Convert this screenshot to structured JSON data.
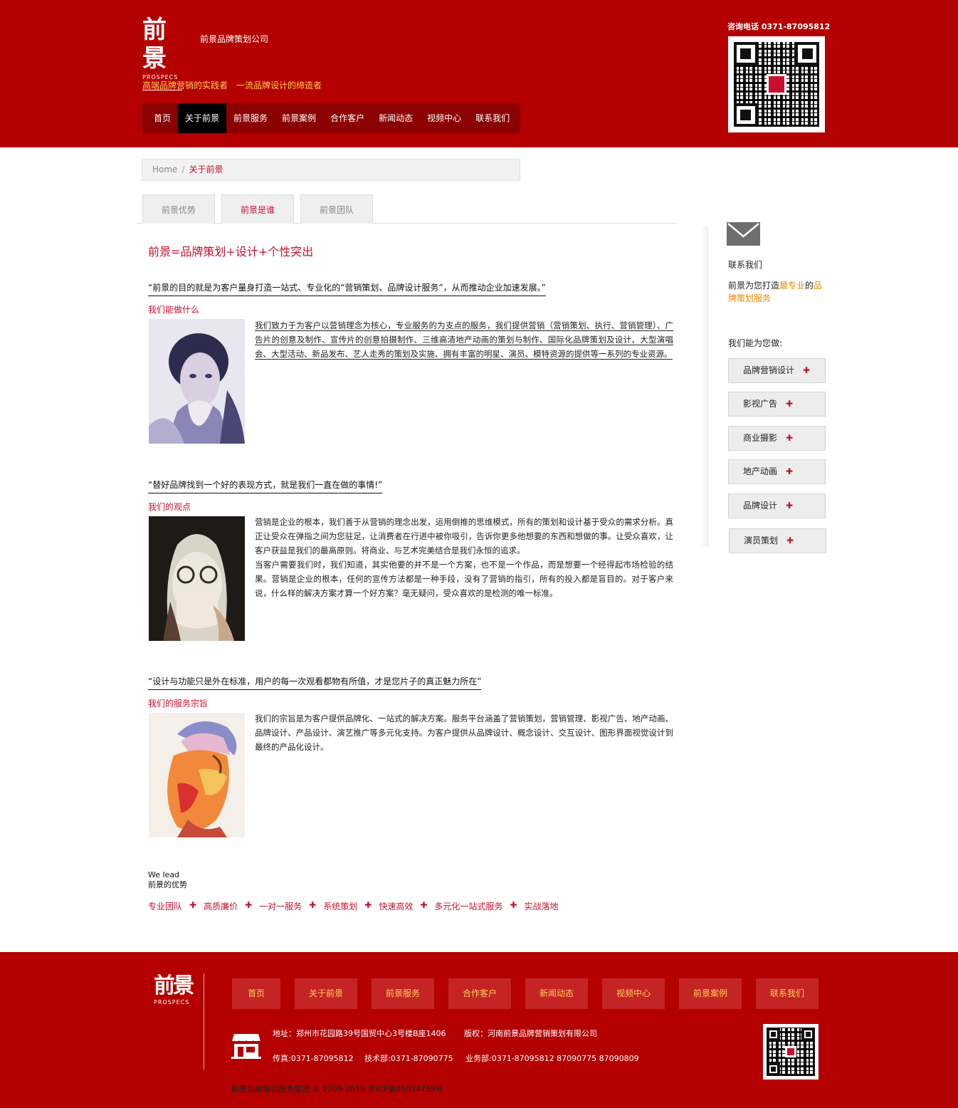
{
  "header": {
    "logo_glyph": "前景",
    "logo_sub": "PROSPECS",
    "company_name": "前景品牌策划公司",
    "slogan": "高端品牌营销的实践者　一流品牌设计的缔造者",
    "hotline": "咨询电话  0371-87095812",
    "nav": [
      {
        "label": "首页",
        "active": false
      },
      {
        "label": "关于前景",
        "active": true
      },
      {
        "label": "前景服务",
        "active": false
      },
      {
        "label": "前景案例",
        "active": false
      },
      {
        "label": "合作客户",
        "active": false
      },
      {
        "label": "新闻动态",
        "active": false
      },
      {
        "label": "视频中心",
        "active": false
      },
      {
        "label": "联系我们",
        "active": false
      }
    ]
  },
  "breadcrumb": {
    "home": "Home",
    "sep": "/",
    "current": "关于前景"
  },
  "tabs": [
    {
      "label": "前景优势",
      "active": false
    },
    {
      "label": "前景是谁",
      "active": true
    },
    {
      "label": "前景团队",
      "active": false
    }
  ],
  "main": {
    "title": "前景=品牌策划+设计+个性突出",
    "sections": [
      {
        "quote": "“前景的目的就是为客户量身打造一站式、专业化的“营销策划、品牌设计服务”，从而推动企业加速发展。”",
        "label": "我们能做什么",
        "text": "我们致力于为客户以营销理念为核心，专业服务的为支点的服务，我们提供营销（营销策划、执行、营销管理）、广告片的创意及制作、宣传片的创意拍摄制作、三维高清地产动画的策划与制作、国际化品牌策划及设计、大型演唱会、大型活动、新品发布、艺人走秀的策划及实施、拥有丰富的明星、演员、模特资源的提供等一系列的专业资源。"
      },
      {
        "quote": "“替好品牌找到一个好的表现方式，就是我们一直在做的事情!”",
        "label": "我们的观点",
        "text": "营销是企业的根本，我们善于从营销的理念出发，运用倒推的思维模式，所有的策划和设计基于受众的需求分析。真正让受众在弹指之间为您驻足，让消费者在行进中被你吸引，告诉你更多他想要的东西和想做的事。让受众喜欢，让客户获益是我们的最高原则。将商业、与艺术完美结合是我们永恒的追求。",
        "text2": "当客户需要我们时，我们知道，其实他要的并不是一个方案，也不是一个作品，而是想要一个经得起市场检验的结果。营销是企业的根本，任何的宣传方法都是一种手段，没有了营销的指引，所有的投入都是盲目的。对于客户来说，什么样的解决方案才算一个好方案？毫无疑问，受众喜欢的是检测的唯一标准。"
      },
      {
        "quote": "“设计与功能只是外在标准，用户的每一次观看都物有所值，才是您片子的真正魅力所在”",
        "label": "我们的服务宗旨",
        "text": "我们的宗旨是为客户提供品牌化、一站式的解决方案。服务平台涵盖了营销策划，营销管理、影视广告、地产动画、品牌设计、产品设计、演艺推广等多元化支持。为客户提供从品牌设计、概念设计、交互设计、图形界面视觉设计到最终的产品化设计。"
      }
    ],
    "welead": "We lead",
    "advantage_title": "前景的优势",
    "advantages": [
      "专业团队",
      "高质廉价",
      "一对一服务",
      "系统策划",
      "快速高效",
      "多元化一站式服务",
      "实战落地"
    ],
    "plus": "✚"
  },
  "sidebar": {
    "contact": "联系我们",
    "desc_a": "前景为您打造",
    "desc_b": "最专业",
    "desc_c": "的",
    "desc_d": "品牌策划服务",
    "can_do": "我们能为您做:",
    "items": [
      "品牌营销设计",
      "影视广告",
      "商业摄影",
      "地产动画",
      "品牌设计",
      "演员策划"
    ]
  },
  "footer": {
    "nav": [
      "首页",
      "关于前景",
      "前景服务",
      "合作客户",
      "新闻动态",
      "视频中心",
      "前景案例",
      "联系我们"
    ],
    "address": "地址：郑州市花园路39号国贸中心3号楼B座1406",
    "copyright_owner": "版权：河南前景品牌营销策划有限公司",
    "fax": "传真:0371-87095812",
    "tech": "技术部:0371-87090775",
    "biz": "业务部:0371-87095812 87090775 87090809",
    "copy": "前景品牌策划服务集团 © 2009-2019  京ICP备05034759号"
  },
  "colors": {
    "brand_red": "#b40000",
    "accent_red": "#c8102e",
    "gold": "#ffcf5a"
  }
}
